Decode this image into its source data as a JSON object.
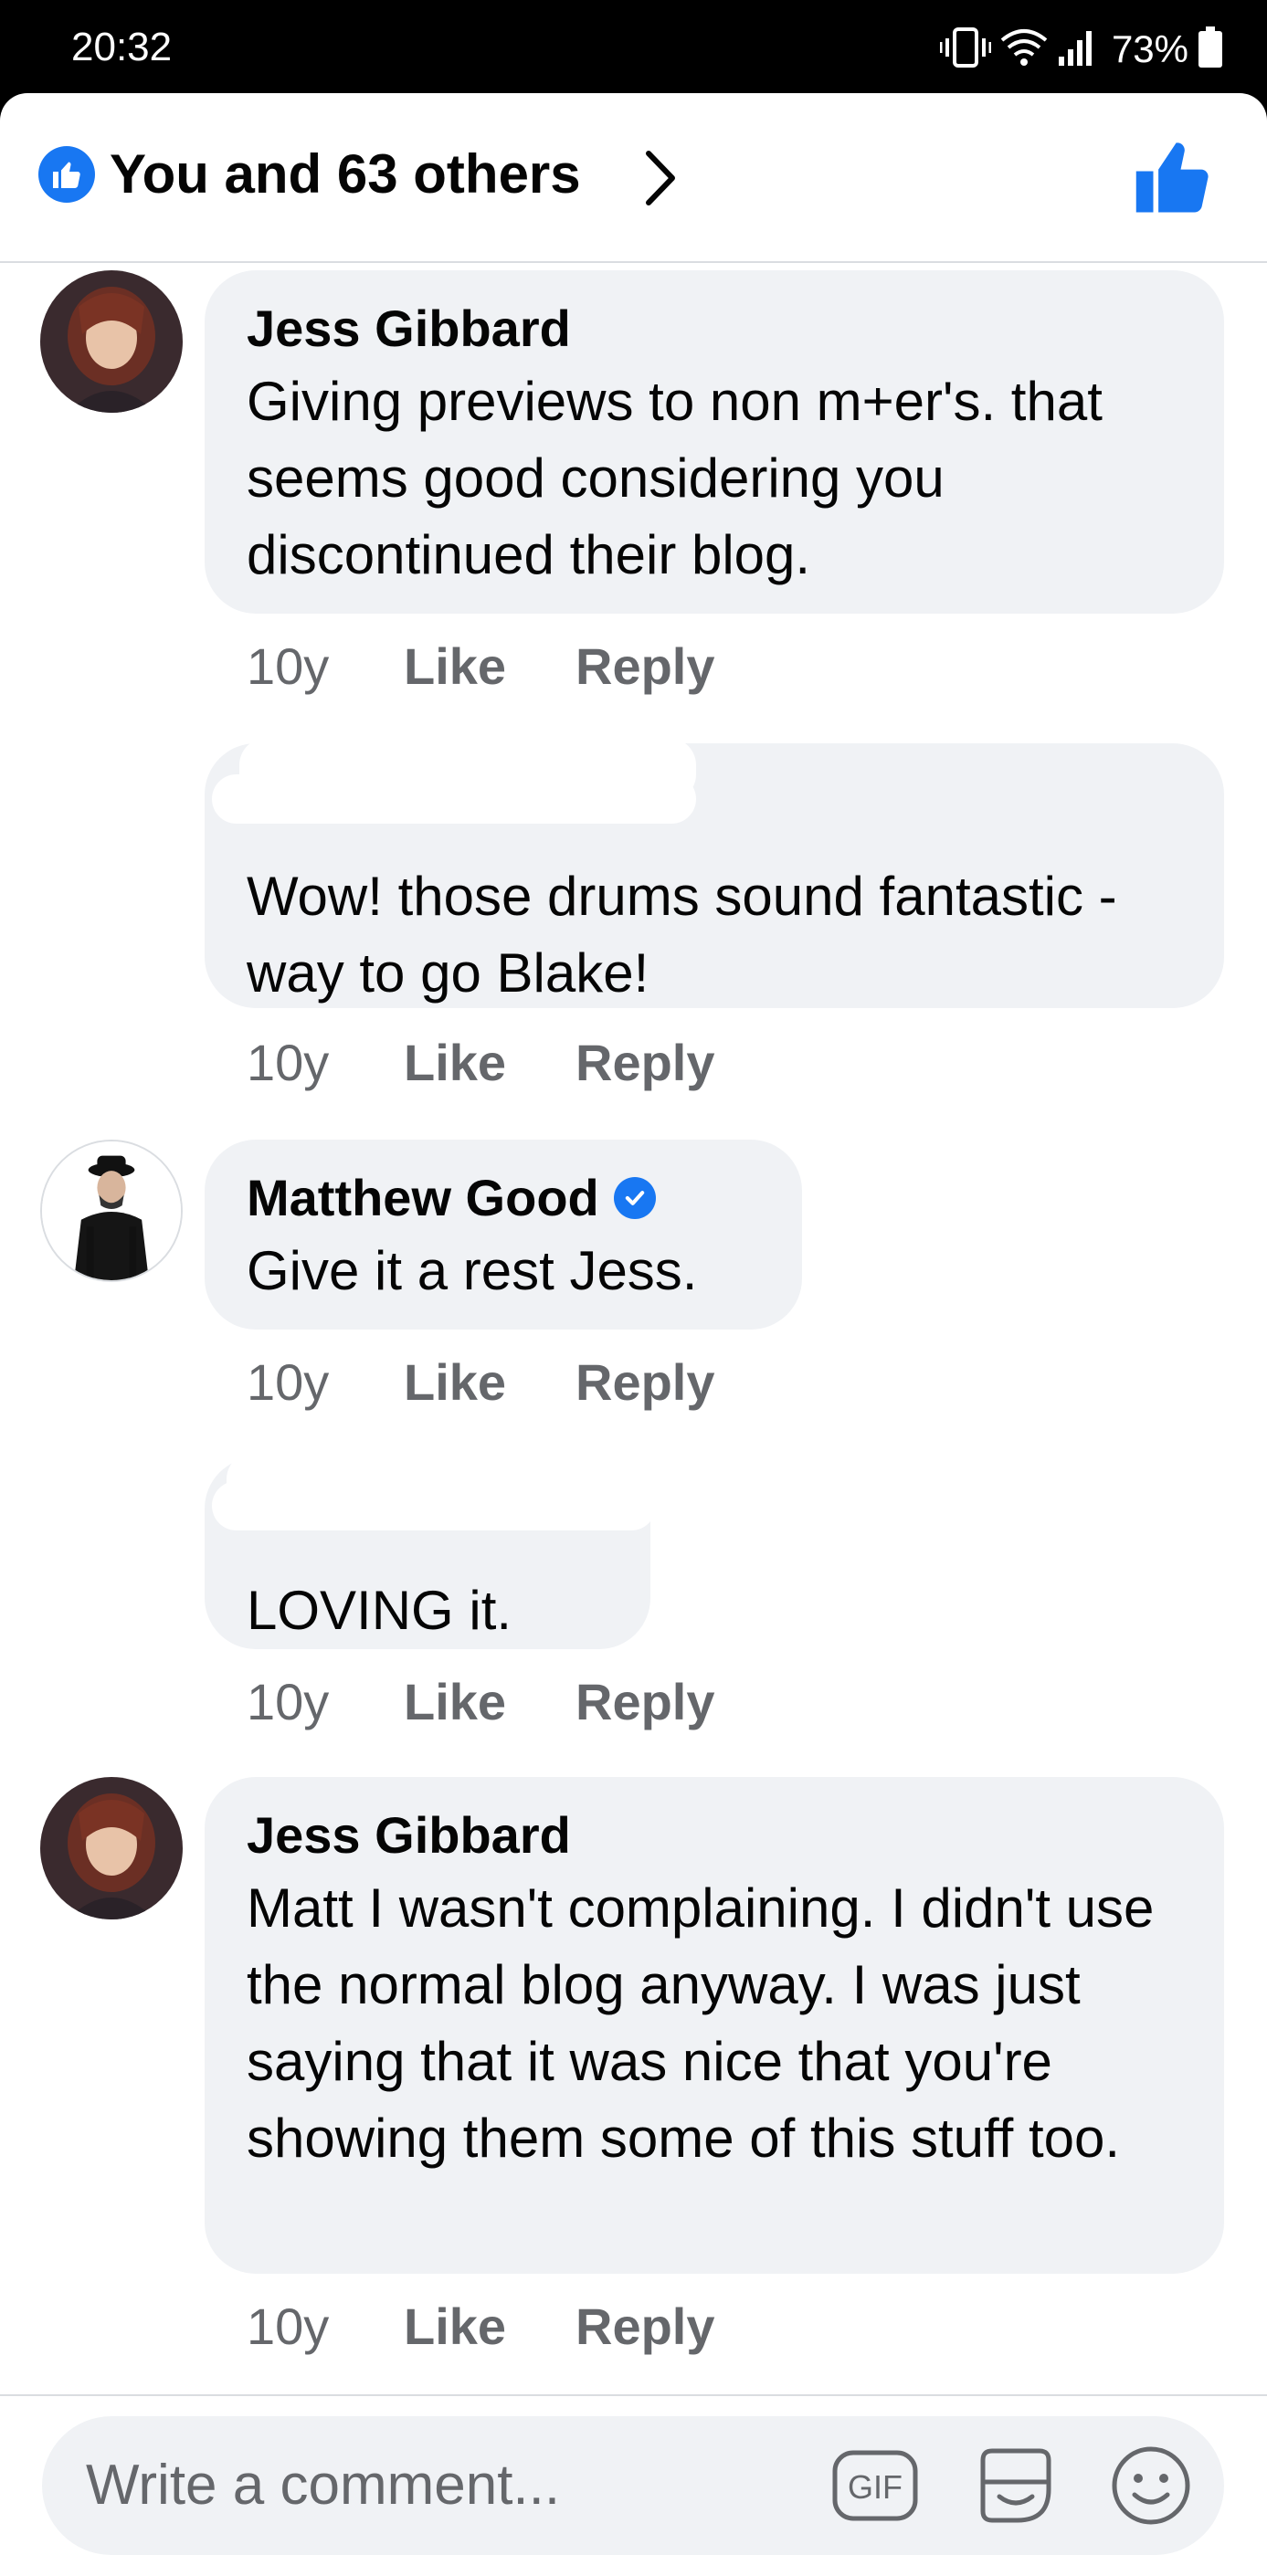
{
  "status_bar": {
    "time": "20:32",
    "battery_percent": "73%",
    "icons": [
      "vibrate-icon",
      "wifi-icon",
      "signal-icon",
      "battery-icon"
    ]
  },
  "header": {
    "reactions_summary": "You and 63 others",
    "reaction_icon": "like-badge-icon",
    "chevron_icon": "chevron-right-icon",
    "like_button_icon": "thumbs-up-icon",
    "accent_color": "#1877f2"
  },
  "comments": [
    {
      "author": "Jess Gibbard",
      "text": "Giving previews to non m+er's. that seems good considering you discontinued their blog.",
      "age": "10y",
      "like_label": "Like",
      "reply_label": "Reply"
    },
    {
      "author": "",
      "text": "Wow! those drums sound fantastic - way to go Blake!",
      "age": "10y",
      "like_label": "Like",
      "reply_label": "Reply"
    },
    {
      "author": "Matthew Good",
      "verified": true,
      "text": "Give it a rest Jess.",
      "age": "10y",
      "like_label": "Like",
      "reply_label": "Reply"
    },
    {
      "author": "",
      "text": "LOVING it.",
      "age": "10y",
      "like_label": "Like",
      "reply_label": "Reply"
    },
    {
      "author": "Jess Gibbard",
      "text": "Matt I wasn't complaining. I didn't use the normal blog anyway. I was just saying that it was nice that you're showing them some of this stuff too.",
      "age": "10y",
      "like_label": "Like",
      "reply_label": "Reply"
    }
  ],
  "composer": {
    "placeholder": "Write a comment...",
    "gif_label": "GIF",
    "sticker_icon": "sticker-icon",
    "emoji_icon": "emoji-icon"
  },
  "colors": {
    "bubble": "#f0f2f5",
    "secondary_text": "#65676b",
    "primary_text": "#050505"
  }
}
